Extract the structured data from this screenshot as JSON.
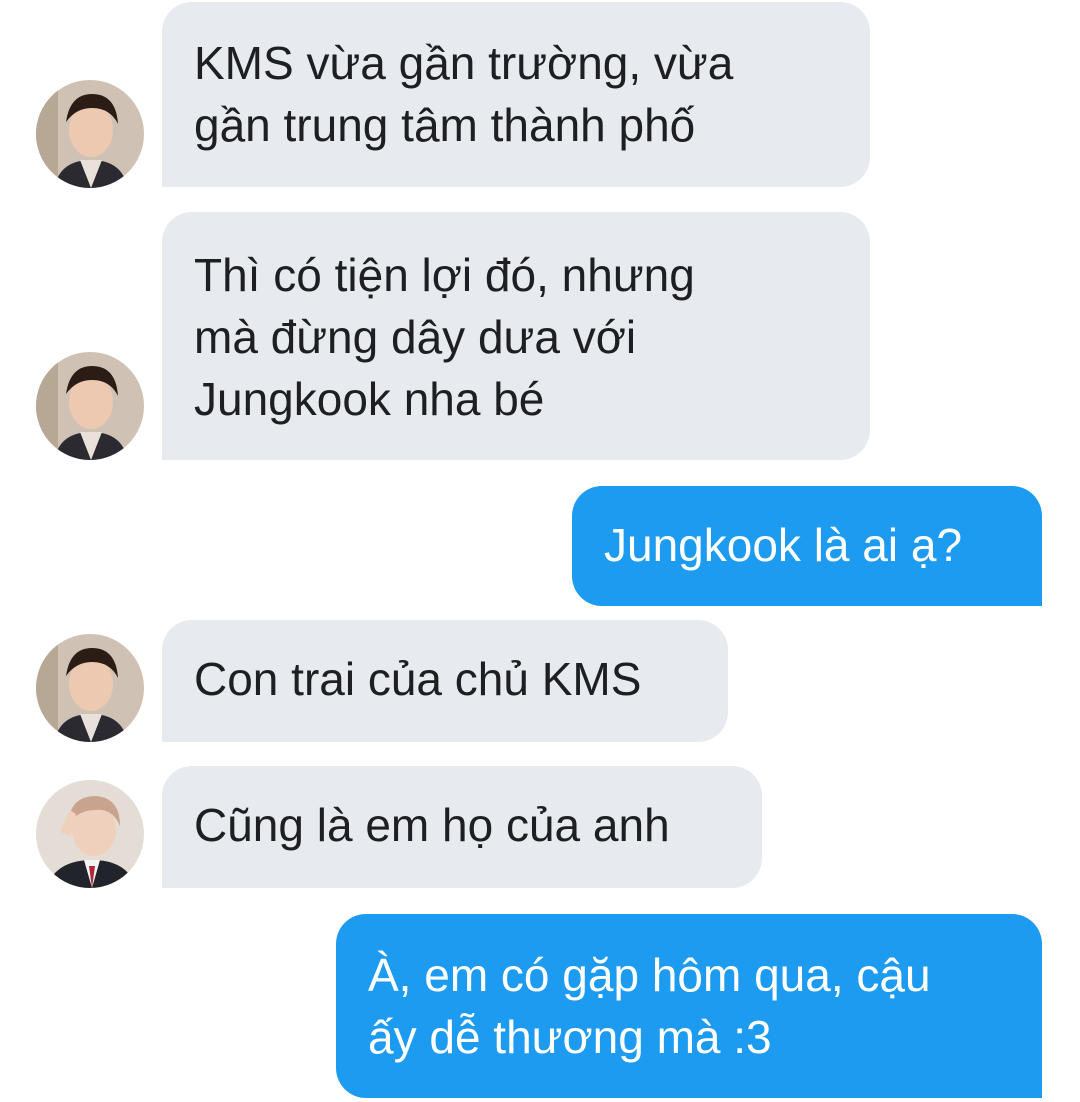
{
  "conversation": {
    "messages": [
      {
        "direction": "incoming",
        "sender": "jin",
        "text": "KMS vừa gần trường, vừa\ngần trung tâm thành phố"
      },
      {
        "direction": "incoming",
        "sender": "jin",
        "text": "Thì có tiện lợi đó, nhưng\nmà đừng dây dưa với\nJungkook nha bé"
      },
      {
        "direction": "outgoing",
        "sender": "me",
        "text": "Jungkook là ai ạ?"
      },
      {
        "direction": "incoming",
        "sender": "jin",
        "text": "Con trai của chủ KMS"
      },
      {
        "direction": "incoming",
        "sender": "rm",
        "text": "Cũng là em họ của anh"
      },
      {
        "direction": "outgoing",
        "sender": "me",
        "text": "À, em có gặp hôm qua, cậu\nấy dễ thương mà :3"
      }
    ]
  },
  "colors": {
    "incoming_bubble": "#e7eaee",
    "outgoing_bubble": "#1d9bf0",
    "incoming_text": "#1d1f22",
    "outgoing_text": "#ffffff"
  }
}
